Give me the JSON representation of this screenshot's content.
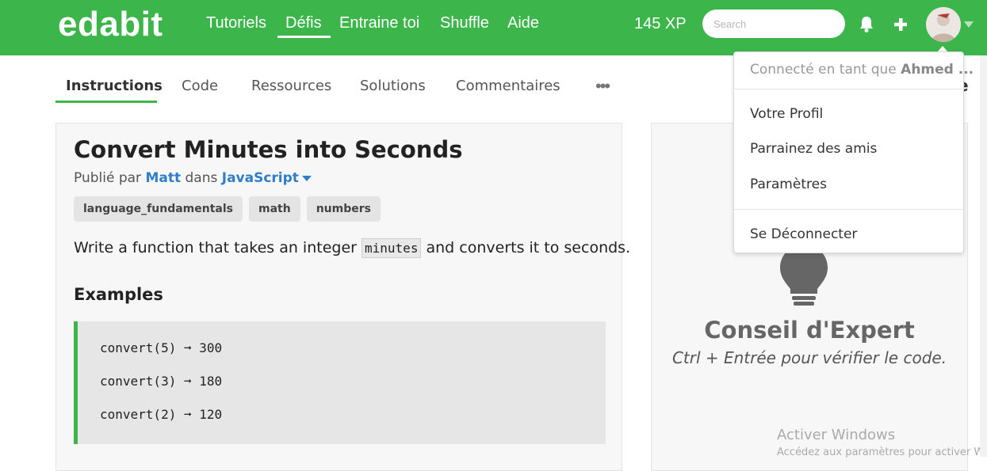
{
  "header": {
    "logo": "edabit",
    "nav": [
      "Tutoriels",
      "Défis",
      "Entraine toi",
      "Shuffle",
      "Aide"
    ],
    "active_nav": "Défis",
    "xp": "145 XP",
    "search_placeholder": "Search",
    "icons": [
      "bell-icon",
      "plus-icon",
      "avatar",
      "chevron-down-icon"
    ]
  },
  "tabs": {
    "items": [
      "Instructions",
      "Code",
      "Ressources",
      "Solutions",
      "Commentaires"
    ],
    "active": "Instructions",
    "more": "•••",
    "partial_right": "e"
  },
  "challenge": {
    "title": "Convert Minutes into Seconds",
    "published_by": "Publié par",
    "author": "Matt",
    "in": "dans",
    "language": "JavaScript",
    "tags": [
      "language_fundamentals",
      "math",
      "numbers"
    ],
    "desc_before": "Write a function that takes an integer",
    "desc_code": "minutes",
    "desc_after": "and converts it to seconds.",
    "examples_heading": "Examples",
    "examples": [
      "convert(5) ➞ 300",
      "convert(3) ➞ 180",
      "convert(2) ➞ 120"
    ]
  },
  "tip": {
    "heading": "Conseil d'Expert",
    "text": "Ctrl + Entrée pour vérifier le code."
  },
  "user_menu": {
    "connected_as": "Connecté en tant que",
    "username": "Ahmed ...",
    "items": [
      "Votre Profil",
      "Parrainez des amis",
      "Paramètres"
    ],
    "logout": "Se Déconnecter"
  },
  "windows_watermark": {
    "title": "Activer Windows",
    "subtitle": "Accédez aux paramètres pour activer Wi"
  },
  "colors": {
    "brand_green": "#3cb64a",
    "link_blue": "#2f7ec9"
  }
}
